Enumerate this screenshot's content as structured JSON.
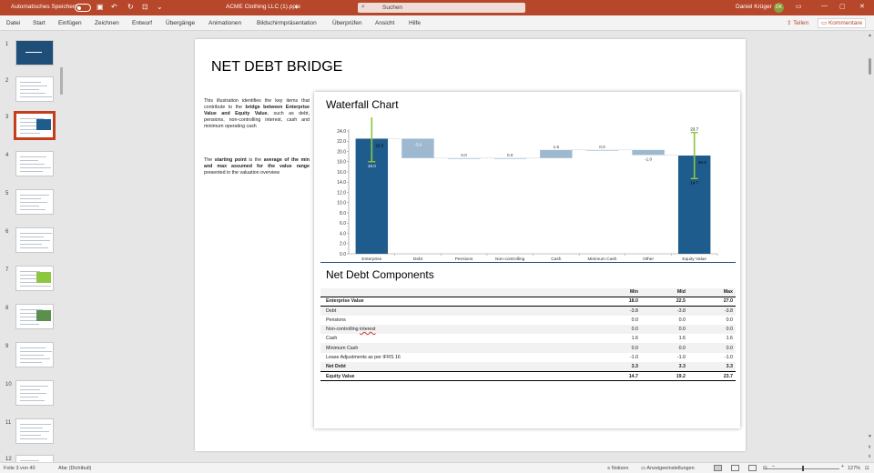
{
  "titlebar": {
    "autosave_label": "Automatisches Speichern",
    "file_name": "ACME Clothing LLC (1).pptx",
    "search_placeholder": "Suchen",
    "user_name": "Daniel Krüger",
    "user_initials": "DK"
  },
  "ribbon": {
    "tabs": [
      "Datei",
      "Start",
      "Einfügen",
      "Zeichnen",
      "Entwurf",
      "Übergänge",
      "Animationen",
      "Bildschirmpräsentation",
      "Überprüfen",
      "Ansicht",
      "Hilfe"
    ],
    "share_label": "Teilen",
    "comments_label": "Kommentare"
  },
  "thumbnails": {
    "numbers": [
      "1",
      "2",
      "3",
      "4",
      "5",
      "6",
      "7",
      "8",
      "9",
      "10",
      "11",
      "12"
    ],
    "selected": 3
  },
  "slide": {
    "title": "NET DEBT BRIDGE",
    "description_1": {
      "pre": "This illustration identifies the key items that contribute to the ",
      "bold": "bridge between Enterprise Value and Equity Value",
      "post": ", such as debt, pensions, non-controlling interest, cash and minimum operating cash"
    },
    "description_2": {
      "pre1": "The ",
      "bold1": "starting point",
      "mid": " is the ",
      "bold2": "average of the min and max assumed for the value range",
      "post": " presented in the valuation overview"
    },
    "chart_title": "Waterfall Chart",
    "components_title": "Net Debt Components"
  },
  "chart_data": {
    "type": "bar",
    "categories": [
      "Enterprise Value",
      "Debt",
      "Pensions",
      "Non-controlling interest",
      "Cash",
      "Minimum Cash",
      "Other",
      "Equity Value"
    ],
    "values": [
      22.5,
      -3.8,
      0.0,
      0.0,
      1.6,
      0.0,
      -1.0,
      19.2
    ],
    "data_labels": [
      "22.5",
      "-3.8",
      "0.0",
      "0.0",
      "1.6",
      "0.0",
      "-1.0",
      "19.2"
    ],
    "range_ev": {
      "min": 18.0,
      "max": 27.0,
      "min_label": "18.0",
      "max_label": "27.0"
    },
    "range_eq": {
      "min": 14.7,
      "max": 23.7,
      "min_label": "14.7",
      "max_label": "23.7"
    },
    "ylim": [
      0,
      24
    ],
    "yticks": [
      "0.0",
      "2.0",
      "4.0",
      "6.0",
      "8.0",
      "10.0",
      "12.0",
      "14.0",
      "16.0",
      "18.0",
      "20.0",
      "22.0",
      "24.0"
    ],
    "colors": {
      "total": "#1f5c8e",
      "step": "#9db8cf",
      "range": "#8dc63f"
    }
  },
  "table": {
    "headers": [
      "Min",
      "Mid",
      "Max"
    ],
    "rows": [
      {
        "label": "Enterprise Value",
        "min": "18.0",
        "mid": "22.5",
        "max": "27.0"
      },
      {
        "label": "Debt",
        "min": "-3.8",
        "mid": "-3.8",
        "max": "-3.8"
      },
      {
        "label": "Pensions",
        "min": "0.0",
        "mid": "0.0",
        "max": "0.0"
      },
      {
        "label_pre": "Non-controlling ",
        "label_u": "interest",
        "min": "0.0",
        "mid": "0.0",
        "max": "0.0"
      },
      {
        "label": "Cash",
        "min": "1.6",
        "mid": "1.6",
        "max": "1.6"
      },
      {
        "label": "Minimum Cash",
        "min": "0.0",
        "mid": "0.0",
        "max": "0.0"
      },
      {
        "label": "Lease Adjustments as per IFRS 16",
        "min": "-1.0",
        "mid": "-1.0",
        "max": "-1.0"
      },
      {
        "label": "Net Debt",
        "min": "3.3",
        "mid": "3.3",
        "max": "3.3"
      },
      {
        "label": "Equity Value",
        "min": "14.7",
        "mid": "19.2",
        "max": "23.7"
      }
    ]
  },
  "statusbar": {
    "slide_counter": "Folie 3 von 40",
    "theme": "Afar (Dichtbull)",
    "notes_label": "Notizen",
    "display_settings_label": "Anzeigeeinstellungen",
    "zoom": "127%"
  }
}
